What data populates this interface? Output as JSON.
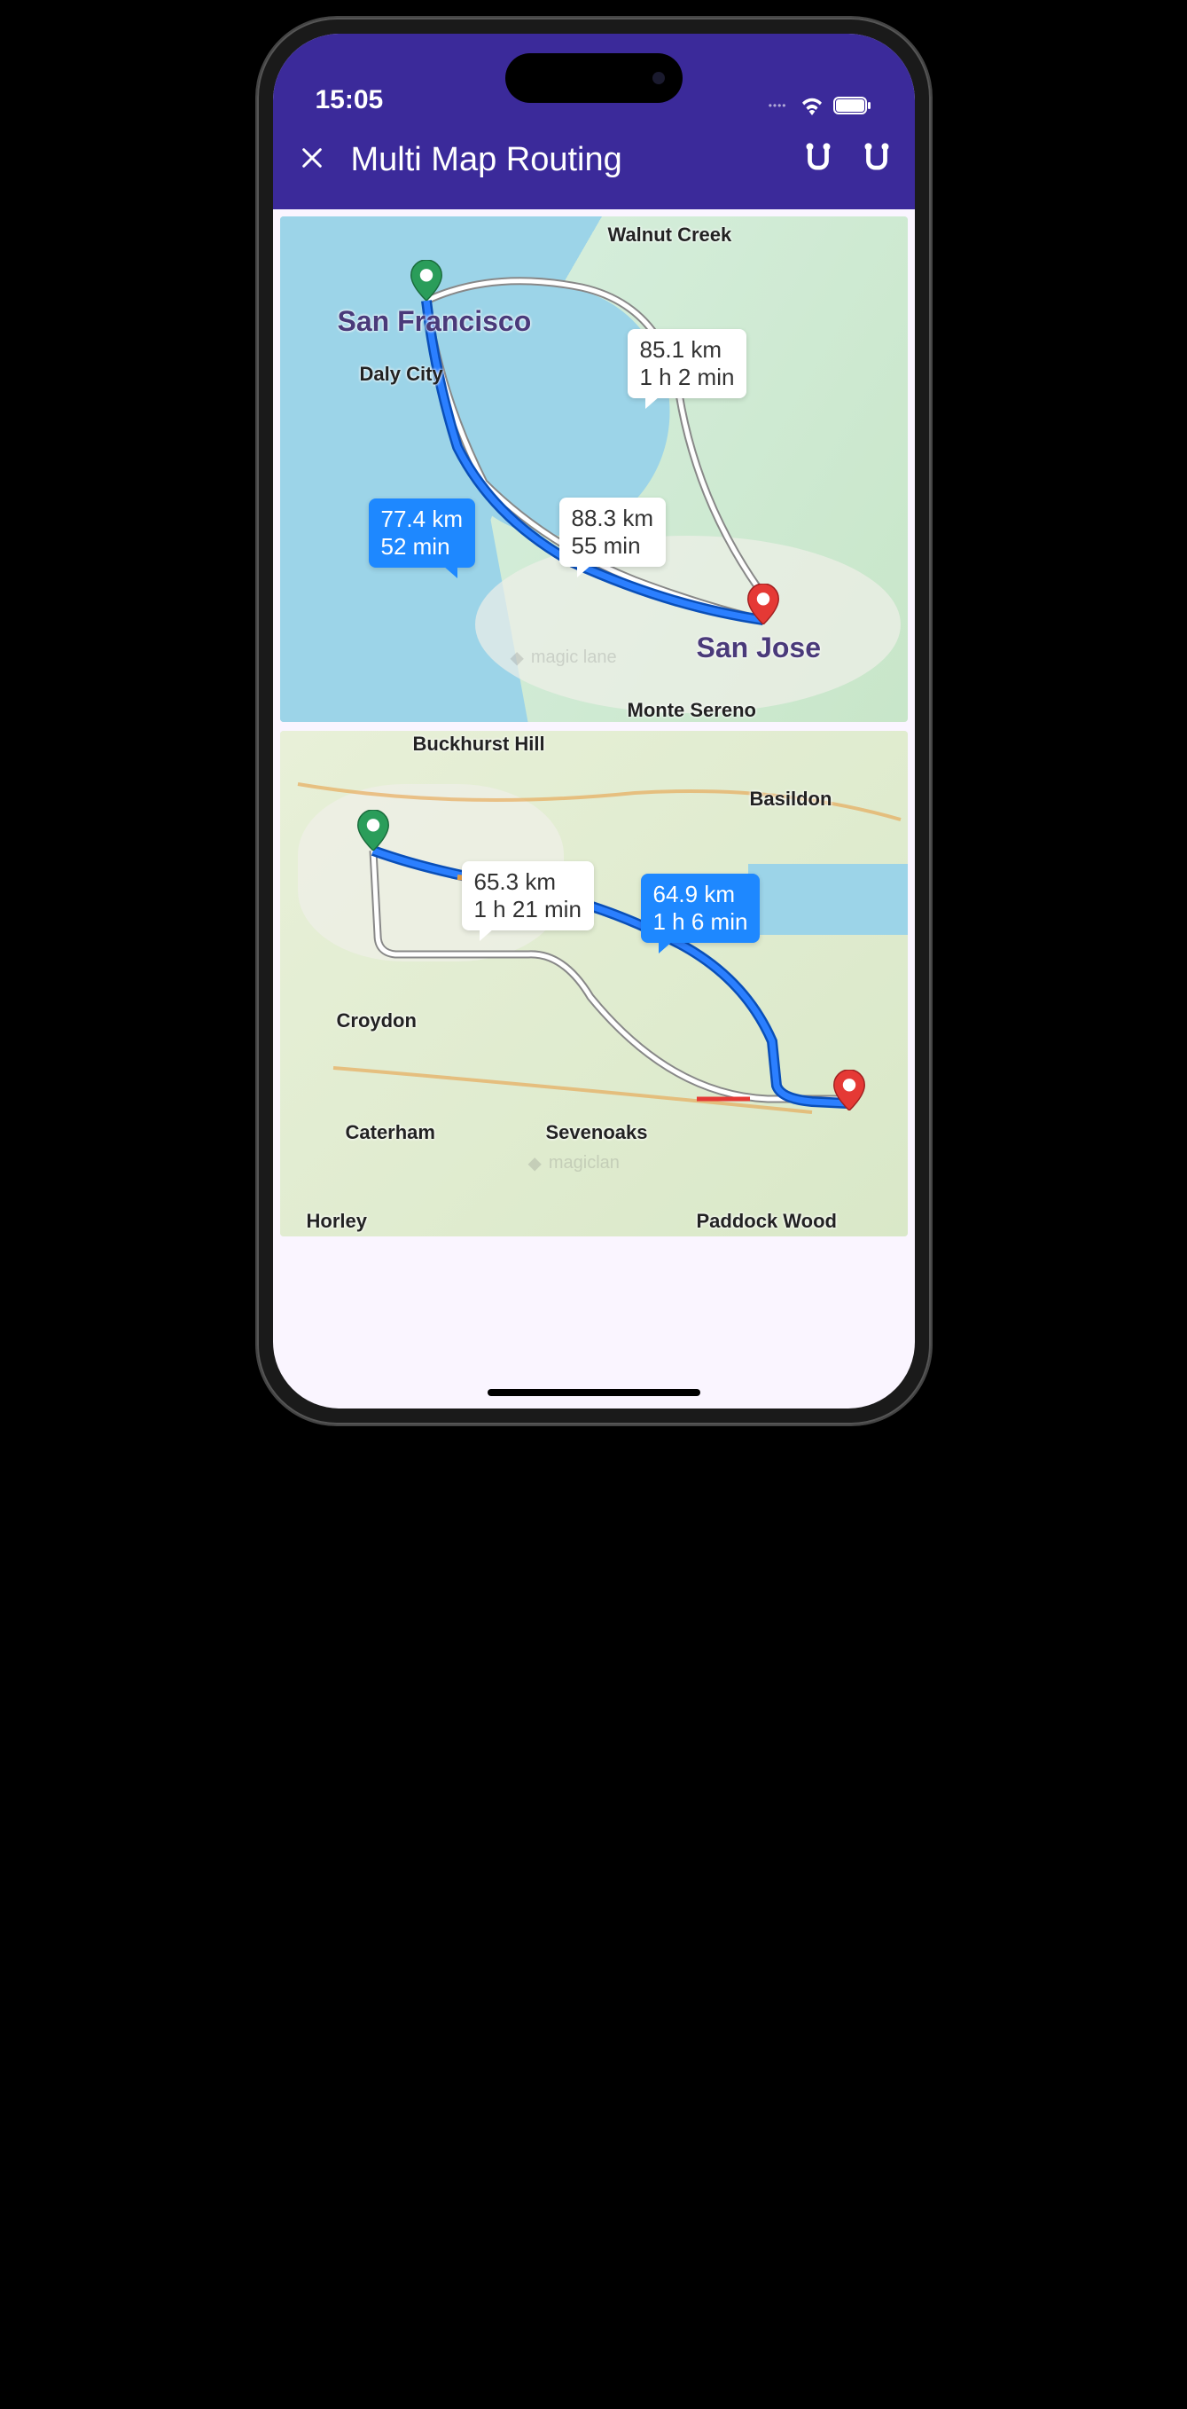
{
  "status": {
    "time": "15:05"
  },
  "header": {
    "title": "Multi Map Routing"
  },
  "maps": [
    {
      "cities": {
        "walnut_creek": "Walnut Creek",
        "san_francisco": "San Francisco",
        "daly_city": "Daly City",
        "san_jose": "San Jose",
        "monte_sereno": "Monte Sereno"
      },
      "routes": [
        {
          "distance": "77.4 km",
          "duration": "52 min",
          "selected": true
        },
        {
          "distance": "88.3 km",
          "duration": "55 min",
          "selected": false
        },
        {
          "distance": "85.1 km",
          "duration": "1 h 2 min",
          "selected": false
        }
      ],
      "watermark": "magic lane"
    },
    {
      "cities": {
        "buckhurst_hill": "Buckhurst Hill",
        "basildon": "Basildon",
        "croydon": "Croydon",
        "caterham": "Caterham",
        "sevenoaks": "Sevenoaks",
        "paddock_wood": "Paddock Wood",
        "horley": "Horley"
      },
      "routes": [
        {
          "distance": "64.9 km",
          "duration": "1 h 6 min",
          "selected": true
        },
        {
          "distance": "65.3 km",
          "duration": "1 h 21 min",
          "selected": false
        }
      ],
      "watermark": "magiclan"
    }
  ]
}
